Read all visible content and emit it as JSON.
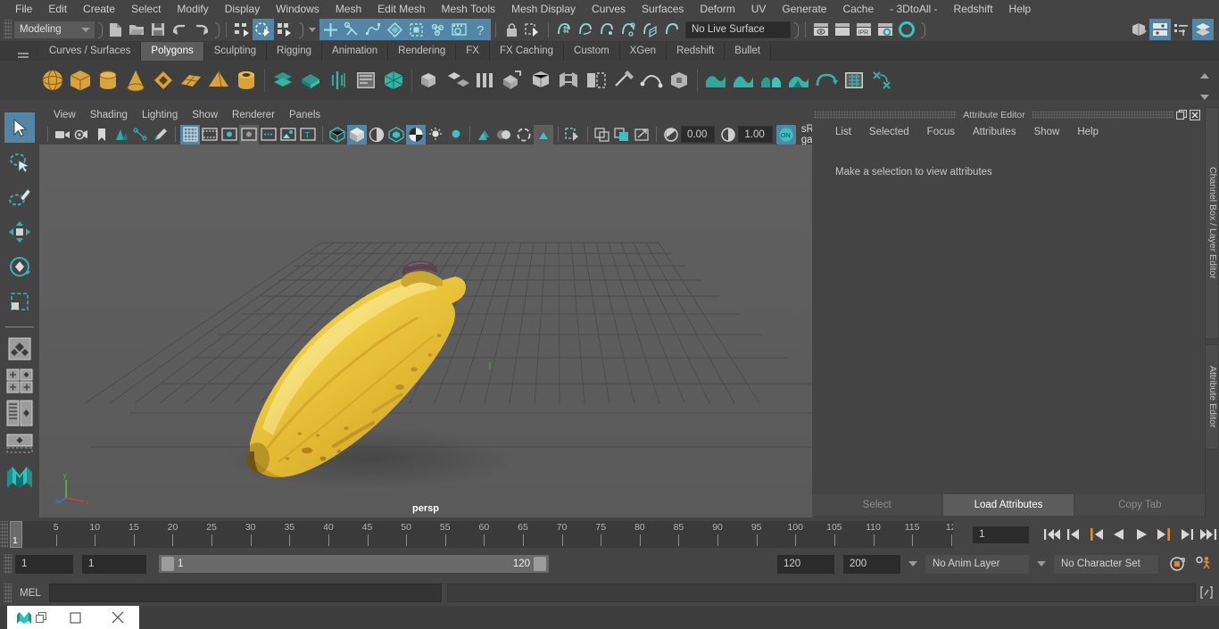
{
  "app": {
    "title": "Autodesk Maya"
  },
  "menubar": {
    "items": [
      "File",
      "Edit",
      "Create",
      "Select",
      "Modify",
      "Display",
      "Windows",
      "Mesh",
      "Edit Mesh",
      "Mesh Tools",
      "Mesh Display",
      "Curves",
      "Surfaces",
      "Deform",
      "UV",
      "Generate",
      "Cache",
      "- 3DtoAll -",
      "Redshift",
      "Help"
    ]
  },
  "statusline": {
    "menu_set": "Modeling",
    "live_surface": "No Live Surface",
    "icons_file": [
      "new-scene-icon",
      "open-scene-icon",
      "save-scene-icon",
      "undo-icon",
      "redo-icon"
    ],
    "icons_select_mode": [
      "select-by-hierarchy-icon",
      "select-by-object-type-icon",
      "select-by-component-type-icon"
    ],
    "icons_masks": [
      "select-handles-icon",
      "select-joints-icon",
      "select-curves-icon",
      "select-surfaces-icon",
      "select-deformations-icon",
      "select-dynamics-icon",
      "select-rendering-icon",
      "select-misc-icon"
    ],
    "icons_lock": [
      "lock-selection-icon",
      "highlight-selection-icon"
    ],
    "icons_snap": [
      "snap-to-grid-icon",
      "snap-to-curve-icon",
      "snap-to-point-icon",
      "snap-to-projected-center-icon",
      "snap-to-view-plane-icon",
      "make-live-icon"
    ],
    "icons_render": [
      "render-current-frame-icon",
      "render-sequence-icon",
      "ipr-render-icon",
      "render-settings-icon",
      "hypershade-icon"
    ],
    "icons_editors": [
      "show-hide-modeling-editor-icon",
      "attribute-editor-toggle-icon",
      "channel-box-toggle-icon",
      "layer-editor-toggle-icon"
    ]
  },
  "shelf": {
    "tabs": [
      "Curves / Surfaces",
      "Polygons",
      "Sculpting",
      "Rigging",
      "Animation",
      "Rendering",
      "FX",
      "FX Caching",
      "Custom",
      "XGen",
      "Redshift",
      "Bullet"
    ],
    "active_tab": "Polygons",
    "icons": [
      "poly-sphere-icon",
      "poly-cube-icon",
      "poly-cylinder-icon",
      "poly-cone-icon",
      "poly-torus-icon",
      "poly-plane-icon",
      "poly-pyramid-icon",
      "poly-pipe-icon",
      "poly-helix-icon",
      "poly-soccer-ball-icon",
      "poly-platonic-icon",
      "poly-type-icon",
      "poly-svg-icon",
      "combine-icon",
      "separate-icon",
      "booleans-icon",
      "extrude-icon",
      "bevel-icon",
      "bridge-icon",
      "append-polygon-icon",
      "multi-cut-icon",
      "target-weld-icon",
      "quad-draw-icon",
      "sculpt-icon",
      "smooth-icon",
      "mirror-icon",
      "reduce-icon",
      "remesh-icon",
      "retopologize-icon",
      "crease-icon",
      "uv-editor-icon",
      "transfer-attributes-icon"
    ]
  },
  "toolbox": {
    "tools": [
      "select-tool",
      "lasso-select-tool",
      "paint-select-tool",
      "move-tool",
      "rotate-tool",
      "scale-tool",
      "last-tool-used",
      "single-pane-layout",
      "two-pane-split-layout",
      "three-pane-layout",
      "four-pane-layout",
      "persp-outliner-layout",
      "maya-logo-icon"
    ],
    "active_tool": "select-tool"
  },
  "viewport": {
    "menus": [
      "View",
      "Shading",
      "Lighting",
      "Show",
      "Renderer",
      "Panels"
    ],
    "camera_label": "persp",
    "exposure_value": "0.00",
    "gamma_value": "1.00",
    "color_management": "sRGB gamma",
    "toolbar_icons": [
      "select-camera-icon",
      "camera-attributes-icon",
      "bookmark-icon",
      "image-plane-icon",
      "twopoint-resolution-icon",
      "grease-pencil-icon",
      "grid-toggle-icon",
      "film-gate-icon",
      "resolution-gate-icon",
      "gate-mask-icon",
      "film-origin-icon",
      "safe-action-icon",
      "show-hud-icon",
      "wireframe-icon",
      "smooth-shade-icon",
      "shaded-wireframe-icon",
      "use-default-material-icon",
      "textured-icon",
      "use-all-lights-icon",
      "shadows-icon",
      "screen-space-ao-icon",
      "motion-blur-icon",
      "multisample-icon",
      "isolate-select-icon",
      "xray-icon",
      "xray-joints-icon",
      "xray-active-components-icon",
      "exposure-icon",
      "gamma-icon",
      "color-management-toggle-icon"
    ],
    "active_toolbar_icons": [
      "grid-toggle-icon",
      "smooth-shade-icon",
      "textured-icon",
      "color-management-toggle-icon"
    ],
    "scene": {
      "object": "banana",
      "ground": "grid-plane",
      "axis_gizmo": [
        "y",
        "x",
        "z"
      ]
    }
  },
  "attribute_editor": {
    "panel_title": "Attribute Editor",
    "menus": [
      "List",
      "Selected",
      "Focus",
      "Attributes",
      "Show",
      "Help"
    ],
    "empty_message": "Make a selection to view attributes",
    "buttons": [
      {
        "label": "Select",
        "enabled": false
      },
      {
        "label": "Load Attributes",
        "enabled": true
      },
      {
        "label": "Copy Tab",
        "enabled": false
      }
    ],
    "titlebar_icons": [
      "undock-panel-icon",
      "close-panel-icon"
    ],
    "side_tabs": [
      "Channel Box / Layer Editor",
      "Attribute Editor"
    ]
  },
  "timeline": {
    "tick_labels": [
      "5",
      "10",
      "15",
      "20",
      "25",
      "30",
      "35",
      "40",
      "45",
      "50",
      "55",
      "60",
      "65",
      "70",
      "75",
      "80",
      "85",
      "90",
      "95",
      "100",
      "105",
      "110",
      "115",
      "12"
    ],
    "start_frame": "1",
    "end_frame": "120",
    "current_frame": "1",
    "playhead_label": "1",
    "playback_buttons": [
      "go-to-start-icon",
      "step-back-keyframe-icon",
      "step-back-frame-icon",
      "play-backwards-icon",
      "play-forwards-icon",
      "step-forward-frame-icon",
      "step-forward-keyframe-icon",
      "go-to-end-icon"
    ]
  },
  "range_slider": {
    "anim_start": "1",
    "range_start": "1",
    "bar_start_label": "1",
    "bar_end_label": "120",
    "range_end": "120",
    "anim_end": "200",
    "anim_layer": "No Anim Layer",
    "character_set": "No Character Set",
    "right_icons": [
      "auto-keyframe-toggle-icon",
      "animation-preferences-icon"
    ]
  },
  "command_line": {
    "language_label": "MEL",
    "input_value": "",
    "output_value": "",
    "script_editor_icon": "script-editor-icon"
  },
  "taskbar": {
    "buttons": [
      "app-icon",
      "restore-window-icon",
      "maximize-window-icon",
      "close-window-icon"
    ]
  },
  "colors": {
    "accent_blue": "#5285a6",
    "panel_bg": "#444444",
    "viewport_bg": "#5d5d5d",
    "teal_icon": "#3fb6b6",
    "orange": "#e08a32"
  }
}
